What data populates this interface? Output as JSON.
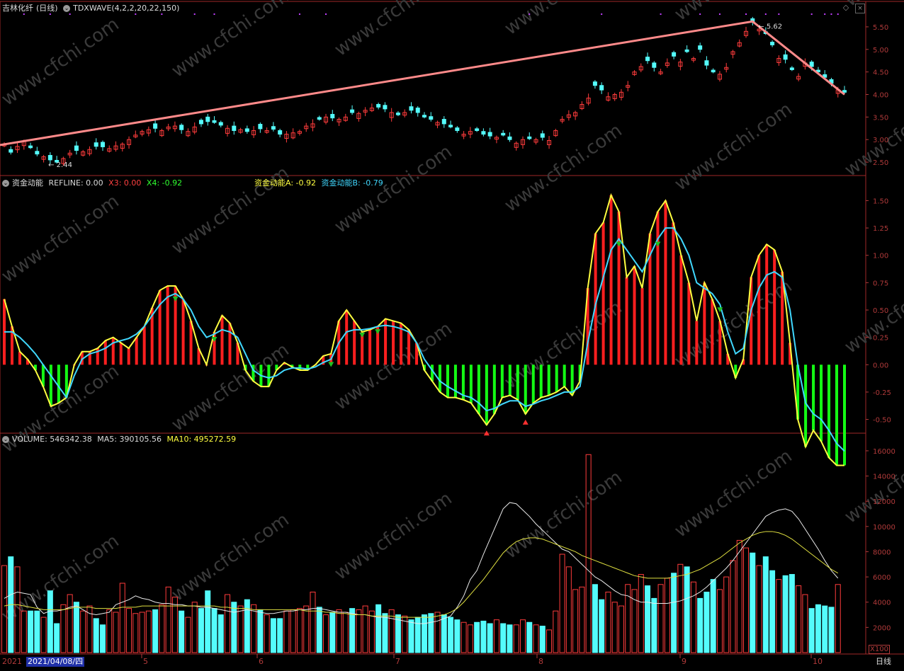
{
  "stock": {
    "name": "吉林化纤",
    "period": "(日线)"
  },
  "wave_indicator": {
    "name": "TDXWAVE(4,2,2,20,22,150)"
  },
  "fund_indicator": {
    "name": "资金动能",
    "refline": "REFLINE: 0.00",
    "x3": "X3: 0.00",
    "x4": "X4: -0.92",
    "a_label": "资金动能A: -0.92",
    "b_label": "资金动能B: -0.79"
  },
  "volume_indicator": {
    "vol": "VOLUME: 546342.38",
    "ma5": "MA5: 390105.56",
    "ma10": "MA10: 495272.59"
  },
  "annotations": {
    "high": "5.62",
    "low": "2.44"
  },
  "footer": {
    "year_stub": "2021",
    "selected_date": "2021/04/08/四",
    "period_label": "日线",
    "unit": "X100"
  },
  "watermark": "www.cfchi.com",
  "colors": {
    "up": "#ff3c3c",
    "down": "#54fcfc",
    "bar_pos": "#ff1f1f",
    "bar_neg": "#14ff14",
    "line_a": "#ffff40",
    "line_b": "#40d8ff",
    "wave": "#ff8a8a",
    "axis": "#b03a3a"
  },
  "chart_data": [
    {
      "type": "candlestick",
      "title": "吉林化纤 (日线)",
      "x_ticks": [
        "5",
        "6",
        "7",
        "8",
        "9",
        "10"
      ],
      "y_ticks": [
        "5.50",
        "5.00",
        "4.50",
        "4.00",
        "3.50",
        "3.00",
        "2.50"
      ],
      "ylim": [
        2.25,
        5.75
      ],
      "close": [
        2.9,
        2.72,
        2.85,
        2.96,
        2.82,
        2.68,
        2.62,
        2.55,
        2.5,
        2.58,
        2.7,
        2.76,
        2.73,
        2.78,
        2.85,
        2.84,
        2.8,
        2.86,
        2.9,
        3.0,
        3.1,
        3.18,
        3.22,
        3.25,
        3.2,
        3.28,
        3.3,
        3.22,
        3.18,
        3.28,
        3.35,
        3.4,
        3.38,
        3.32,
        3.25,
        3.2,
        3.22,
        3.18,
        3.2,
        3.24,
        3.2,
        3.23,
        3.12,
        3.12,
        3.15,
        3.18,
        3.3,
        3.35,
        3.45,
        3.5,
        3.48,
        3.45,
        3.5,
        3.6,
        3.58,
        3.65,
        3.7,
        3.72,
        3.68,
        3.6,
        3.55,
        3.6,
        3.65,
        3.6,
        3.5,
        3.45,
        3.38,
        3.35,
        3.28,
        3.2,
        3.12,
        3.18,
        3.2,
        3.12,
        3.08,
        3.05,
        3.1,
        3.0,
        2.92,
        3.0,
        3.02,
        3.0,
        3.05,
        2.98,
        3.2,
        3.45,
        3.55,
        3.6,
        3.78,
        3.92,
        4.2,
        4.1,
        3.95,
        4.0,
        4.05,
        4.2,
        4.5,
        4.62,
        4.75,
        4.6,
        4.5,
        4.7,
        4.85,
        4.72,
        4.95,
        4.8,
        5.0,
        4.65,
        4.5,
        4.45,
        4.6,
        4.95,
        5.15,
        5.4,
        5.6,
        5.45,
        5.35,
        5.1,
        4.8,
        4.78,
        4.55,
        4.4,
        4.7,
        4.62,
        4.5,
        4.38,
        4.25,
        4.1,
        4.05
      ],
      "bull": [
        1,
        0,
        1,
        1,
        0,
        0,
        1,
        0,
        0,
        1,
        1,
        0,
        1,
        1,
        0,
        0,
        1,
        1,
        1,
        1,
        1,
        1,
        1,
        0,
        1,
        1,
        1,
        0,
        1,
        1,
        0,
        0,
        0,
        0,
        1,
        0,
        1,
        0,
        1,
        0,
        1,
        0,
        0,
        1,
        1,
        1,
        1,
        1,
        0,
        1,
        0,
        1,
        1,
        0,
        1,
        1,
        1,
        0,
        0,
        1,
        0,
        1,
        0,
        0,
        0,
        0,
        1,
        0,
        0,
        0,
        1,
        1,
        0,
        0,
        0,
        1,
        0,
        0,
        1,
        1,
        0,
        1,
        0,
        1,
        1,
        1,
        1,
        1,
        1,
        1,
        0,
        0,
        1,
        1,
        1,
        1,
        1,
        1,
        0,
        0,
        1,
        1,
        0,
        1,
        0,
        1,
        0,
        0,
        0,
        1,
        1,
        1,
        1,
        1,
        0,
        1,
        0,
        0,
        1,
        0,
        0,
        1,
        1,
        0,
        0,
        0,
        0,
        1,
        0
      ],
      "volume": [
        6900,
        7600,
        6800,
        3300,
        3300,
        3300,
        2800,
        4900,
        2300,
        3800,
        4600,
        4000,
        3300,
        3700,
        2700,
        2200,
        3400,
        3200,
        5500,
        3500,
        3100,
        3200,
        3300,
        3400,
        3800,
        5200,
        4400,
        3300,
        2800,
        4000,
        3500,
        4900,
        3500,
        3000,
        4600,
        4000,
        3700,
        4200,
        3800,
        3400,
        3000,
        2700,
        2700,
        3300,
        3400,
        3500,
        3700,
        4800,
        3600,
        3000,
        3200,
        3400,
        3200,
        3500,
        3400,
        3700,
        3300,
        3800,
        3100,
        3400,
        3000,
        2900,
        2600,
        2800,
        3000,
        3100,
        3200,
        3000,
        2800,
        2600,
        2400,
        2200,
        2400,
        2500,
        2300,
        2600,
        2300,
        2200,
        2200,
        2600,
        2400,
        2200,
        2100,
        1800,
        3300,
        7800,
        6800,
        5000,
        5200,
        15700,
        5400,
        4200,
        4800,
        4000,
        3700,
        5400,
        5000,
        6200,
        5300,
        4300,
        5400,
        5900,
        6300,
        7000,
        6800,
        5600,
        4300,
        4800,
        5800,
        5000,
        6000,
        7300,
        8900,
        8300,
        7900,
        6900,
        7600,
        6500,
        5800,
        6100,
        6200,
        5300,
        4600,
        3500,
        3800,
        3700,
        3600,
        5400
      ],
      "ma5": [
        4300,
        4600,
        4800,
        4700,
        4600,
        3600,
        3100,
        3300,
        3300,
        3400,
        3600,
        3700,
        3400,
        3100,
        3000,
        3100,
        3200,
        3800,
        4000,
        4200,
        4500,
        4300,
        4200,
        4000,
        3900,
        3900,
        3800,
        3800,
        3700,
        3700,
        3600,
        3600,
        3500,
        3400,
        3300,
        3200,
        3300,
        3400,
        3300,
        3200,
        3100,
        3100,
        3200,
        3300,
        3300,
        3400,
        3400,
        3500,
        3500,
        3400,
        3300,
        3200,
        3200,
        3100,
        3000,
        3000,
        2900,
        2800,
        2800,
        2700,
        2600,
        2500,
        2400,
        2300,
        2300,
        2400,
        2500,
        2700,
        2900,
        3600,
        4500,
        5800,
        6500,
        7800,
        9000,
        10200,
        11400,
        11900,
        11800,
        11300,
        10800,
        10200,
        9700,
        9200,
        8700,
        8200,
        8000,
        7500,
        7000,
        6500,
        6000,
        5700,
        5300,
        4900,
        4600,
        4500,
        4200,
        4000,
        4000,
        3900,
        3900,
        3900,
        4000,
        4100,
        4300,
        4500,
        4800,
        5200,
        5700,
        6200,
        6700,
        7300,
        8000,
        8700,
        9400,
        10100,
        10800,
        11100,
        11300,
        11400,
        11200,
        10600,
        9800,
        9000,
        8200,
        7300,
        6500,
        5900
      ],
      "ma10": [
        3700,
        3800,
        3800,
        3700,
        3600,
        3500,
        3400,
        3400,
        3400,
        3400,
        3500,
        3600,
        3600,
        3600,
        3500,
        3500,
        3500,
        3500,
        3600,
        3600,
        3600,
        3700,
        3700,
        3700,
        3700,
        3700,
        3700,
        3700,
        3700,
        3700,
        3700,
        3700,
        3700,
        3600,
        3600,
        3500,
        3500,
        3500,
        3400,
        3400,
        3400,
        3400,
        3400,
        3400,
        3400,
        3400,
        3300,
        3300,
        3300,
        3200,
        3200,
        3100,
        3100,
        3000,
        3000,
        3000,
        2900,
        2900,
        2900,
        2900,
        2800,
        2800,
        2800,
        2800,
        2800,
        2800,
        2900,
        3000,
        3200,
        3500,
        4000,
        4600,
        5200,
        5800,
        6500,
        7200,
        7900,
        8400,
        8800,
        9000,
        9100,
        9100,
        9000,
        8800,
        8600,
        8400,
        8200,
        8000,
        7700,
        7500,
        7300,
        7100,
        6900,
        6700,
        6500,
        6300,
        6100,
        6000,
        5900,
        5900,
        5900,
        5900,
        6000,
        6100,
        6200,
        6400,
        6600,
        6900,
        7200,
        7500,
        7900,
        8300,
        8700,
        9000,
        9300,
        9500,
        9600,
        9600,
        9500,
        9300,
        9000,
        8600,
        8200,
        7800,
        7400,
        7000,
        6600,
        6300
      ],
      "annotations": [
        "5.62",
        "2.44"
      ]
    },
    {
      "type": "bar+line",
      "title": "资金动能",
      "y_ticks": [
        "1.50",
        "1.25",
        "1.00",
        "0.75",
        "0.50",
        "0.25",
        "0.00",
        "-0.25",
        "-0.50"
      ],
      "ylim": [
        -0.6,
        1.6
      ],
      "values": [
        0.6,
        0.35,
        0.12,
        0.05,
        -0.05,
        -0.2,
        -0.38,
        -0.35,
        -0.3,
        0.0,
        0.12,
        0.12,
        0.15,
        0.22,
        0.25,
        0.2,
        0.15,
        0.25,
        0.35,
        0.52,
        0.68,
        0.72,
        0.72,
        0.6,
        0.4,
        0.15,
        0.0,
        0.3,
        0.45,
        0.38,
        0.2,
        -0.05,
        -0.15,
        -0.2,
        -0.2,
        -0.05,
        0.02,
        -0.02,
        -0.05,
        -0.05,
        0.0,
        0.08,
        0.1,
        0.4,
        0.5,
        0.4,
        0.3,
        0.32,
        0.35,
        0.42,
        0.4,
        0.38,
        0.32,
        0.2,
        -0.05,
        -0.15,
        -0.25,
        -0.3,
        -0.3,
        -0.32,
        -0.35,
        -0.45,
        -0.55,
        -0.45,
        -0.3,
        -0.28,
        -0.32,
        -0.45,
        -0.35,
        -0.3,
        -0.28,
        -0.25,
        -0.2,
        -0.28,
        -0.15,
        0.7,
        1.2,
        1.3,
        1.55,
        1.4,
        0.8,
        0.9,
        0.7,
        1.2,
        1.4,
        1.5,
        1.3,
        1.0,
        0.75,
        0.4,
        0.75,
        0.6,
        0.4,
        0.1,
        -0.12,
        0.05,
        0.8,
        1.0,
        1.1,
        1.05,
        0.85,
        0.2,
        -0.5,
        -0.75,
        -0.6,
        -0.7,
        -0.85,
        -0.92,
        -0.92
      ],
      "line_b": [
        0.3,
        0.3,
        0.25,
        0.18,
        0.1,
        0.0,
        -0.1,
        -0.2,
        -0.3,
        -0.1,
        0.05,
        0.1,
        0.12,
        0.15,
        0.2,
        0.22,
        0.24,
        0.28,
        0.35,
        0.45,
        0.55,
        0.62,
        0.65,
        0.6,
        0.5,
        0.35,
        0.25,
        0.28,
        0.32,
        0.3,
        0.25,
        0.1,
        -0.05,
        -0.1,
        -0.12,
        -0.1,
        -0.05,
        -0.03,
        -0.03,
        -0.04,
        -0.02,
        0.02,
        0.05,
        0.2,
        0.3,
        0.32,
        0.32,
        0.33,
        0.35,
        0.36,
        0.35,
        0.33,
        0.3,
        0.2,
        0.05,
        -0.05,
        -0.15,
        -0.2,
        -0.24,
        -0.28,
        -0.3,
        -0.35,
        -0.42,
        -0.4,
        -0.36,
        -0.33,
        -0.33,
        -0.38,
        -0.36,
        -0.33,
        -0.31,
        -0.28,
        -0.25,
        -0.25,
        -0.2,
        0.2,
        0.55,
        0.8,
        1.05,
        1.15,
        1.05,
        0.95,
        0.85,
        1.0,
        1.15,
        1.25,
        1.25,
        1.15,
        1.0,
        0.75,
        0.7,
        0.65,
        0.55,
        0.3,
        0.1,
        0.15,
        0.5,
        0.7,
        0.82,
        0.85,
        0.8,
        0.5,
        0.0,
        -0.35,
        -0.45,
        -0.5,
        -0.6,
        -0.72,
        -0.79
      ]
    }
  ]
}
